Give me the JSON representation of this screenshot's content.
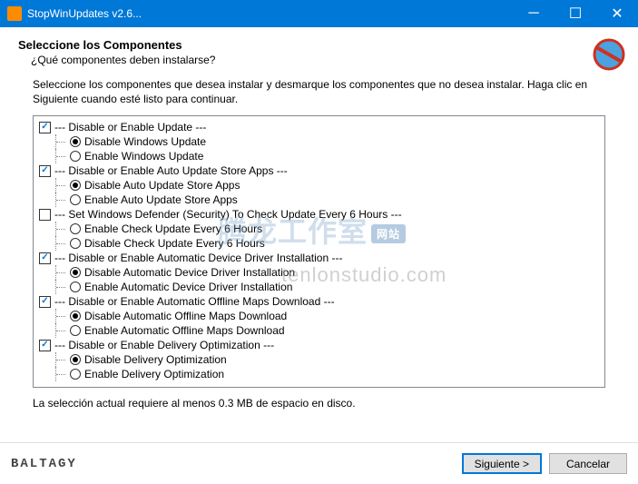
{
  "window": {
    "title": "StopWinUpdates v2.6..."
  },
  "header": {
    "title": "Seleccione los Componentes",
    "subtitle": "¿Qué componentes deben instalarse?"
  },
  "instruction": "Seleccione los componentes que desea instalar y desmarque los componentes que no desea instalar. Haga clic en Siguiente cuando esté listo para continuar.",
  "groups": [
    {
      "label": "--- Disable or Enable Update ---",
      "checked": true,
      "options": [
        {
          "label": "Disable Windows Update",
          "selected": true
        },
        {
          "label": "Enable Windows Update",
          "selected": false
        }
      ]
    },
    {
      "label": "--- Disable or Enable Auto Update Store Apps ---",
      "checked": true,
      "options": [
        {
          "label": "Disable Auto Update Store Apps",
          "selected": true
        },
        {
          "label": "Enable Auto Update Store Apps",
          "selected": false
        }
      ]
    },
    {
      "label": "--- Set Windows Defender (Security) To Check Update Every 6 Hours ---",
      "checked": false,
      "options": [
        {
          "label": "Enable Check Update Every 6 Hours",
          "selected": false
        },
        {
          "label": "Disable Check Update Every 6 Hours",
          "selected": false
        }
      ]
    },
    {
      "label": "--- Disable or Enable Automatic Device Driver Installation ---",
      "checked": true,
      "options": [
        {
          "label": "Disable Automatic Device Driver Installation",
          "selected": true
        },
        {
          "label": "Enable Automatic Device Driver Installation",
          "selected": false
        }
      ]
    },
    {
      "label": "--- Disable or Enable Automatic Offline Maps Download ---",
      "checked": true,
      "options": [
        {
          "label": "Disable Automatic Offline Maps Download",
          "selected": true
        },
        {
          "label": "Enable Automatic Offline Maps Download",
          "selected": false
        }
      ]
    },
    {
      "label": "--- Disable or Enable Delivery Optimization ---",
      "checked": true,
      "options": [
        {
          "label": "Disable Delivery Optimization",
          "selected": true
        },
        {
          "label": "Enable Delivery Optimization",
          "selected": false
        }
      ]
    }
  ],
  "size_requirement": "La selección actual requiere al menos 0.3 MB de espacio en disco.",
  "brand": "BALTAGY",
  "buttons": {
    "next": "Siguiente >",
    "cancel": "Cancelar"
  },
  "watermark": {
    "line1_a": "腾龙工作室",
    "line1_b": "网站",
    "line2": "tenlonstudio.com"
  }
}
